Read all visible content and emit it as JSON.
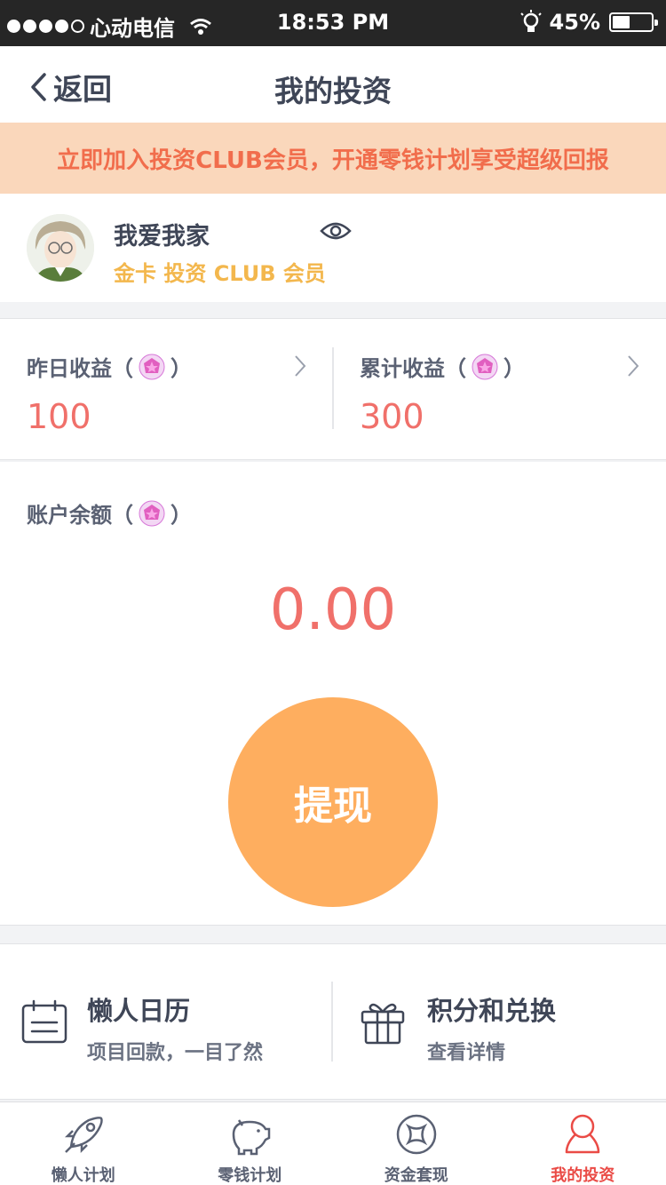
{
  "status_bar": {
    "carrier": "心动电信",
    "time": "18:53 PM",
    "battery": "45%",
    "battery_level": 0.45
  },
  "nav": {
    "back_label": "返回",
    "title": "我的投资"
  },
  "promo_banner": "立即加入投资CLUB会员，开通零钱计划享受超级回报",
  "profile": {
    "name": "我爱我家",
    "level": "金卡 投资 CLUB 会员"
  },
  "earnings": {
    "yesterday": {
      "label_prefix": "昨日收益（",
      "label_suffix": "）",
      "value": "100"
    },
    "total": {
      "label_prefix": "累计收益（",
      "label_suffix": "）",
      "value": "300"
    }
  },
  "balance": {
    "label_prefix": "账户余额（",
    "label_suffix": "）",
    "amount": "0.00",
    "withdraw_label": "提现"
  },
  "features": [
    {
      "title": "懒人日历",
      "subtitle": "项目回款，一目了然",
      "icon": "calendar-icon"
    },
    {
      "title": "积分和兑换",
      "subtitle": "查看详情",
      "icon": "gift-icon"
    }
  ],
  "tabs": [
    {
      "label": "懒人计划",
      "icon": "rocket-icon",
      "active": false
    },
    {
      "label": "零钱计划",
      "icon": "piggy-bank-icon",
      "active": false
    },
    {
      "label": "资金套现",
      "icon": "cash-out-icon",
      "active": false
    },
    {
      "label": "我的投资",
      "icon": "user-icon",
      "active": true
    }
  ],
  "colors": {
    "accent": "#f0706a",
    "banner_bg": "#fad7bb",
    "banner_text": "#f16d4c",
    "gold": "#f3b74d",
    "withdraw_button": "#feae5f",
    "active_tab": "#ea4b46"
  }
}
